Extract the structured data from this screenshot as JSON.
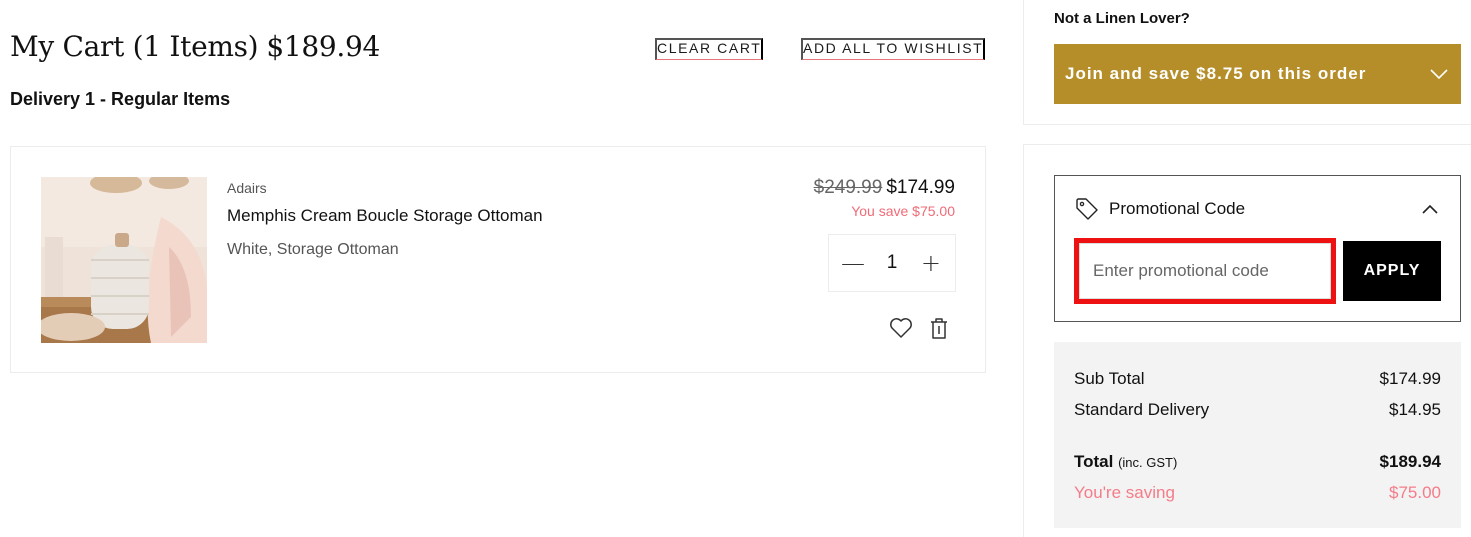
{
  "cart": {
    "title": "My Cart (1 Items)",
    "total_display": "$189.94",
    "clear_cart_label": "CLEAR CART",
    "add_all_wishlist_label": "ADD ALL TO WISHLIST",
    "delivery_heading": "Delivery 1 - Regular Items"
  },
  "item": {
    "brand": "Adairs",
    "name": "Memphis Cream Boucle Storage Ottoman",
    "variant": "White, Storage Ottoman",
    "old_price": "$249.99",
    "price": "$174.99",
    "you_save": "You save $75.00",
    "quantity": "1",
    "minus_symbol": "—",
    "plus_symbol": "+"
  },
  "membership": {
    "question": "Not a Linen Lover?",
    "join_label": "Join and save $8.75 on this order",
    "banner_color": "#b58e2a"
  },
  "promo": {
    "label": "Promotional Code",
    "placeholder": "Enter promotional code",
    "input_value": "",
    "apply_label": "APPLY"
  },
  "summary": {
    "subtotal_label": "Sub Total",
    "subtotal_value": "$174.99",
    "delivery_label": "Standard Delivery",
    "delivery_value": "$14.95",
    "total_label": "Total",
    "total_qualifier": "(inc. GST)",
    "total_value": "$189.94",
    "saving_label": "You're saving",
    "saving_value": "$75.00",
    "saving_color": "#f47c89"
  },
  "icons": {
    "wishlist": "heart-icon",
    "delete": "trash-icon",
    "promo": "tag-icon",
    "expand": "chevron-down-icon",
    "collapse": "chevron-up-icon"
  }
}
